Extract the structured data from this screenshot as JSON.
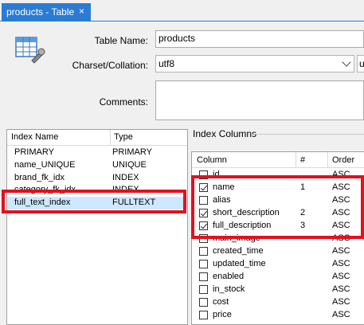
{
  "tab": {
    "title": "products - Table",
    "close_glyph": "×"
  },
  "form": {
    "table_name_label": "Table Name:",
    "table_name_value": "products",
    "charset_label": "Charset/Collation:",
    "charset_value": "utf8",
    "collation_value": "u",
    "comments_label": "Comments:",
    "comments_value": ""
  },
  "indexes": {
    "headers": [
      "Index Name",
      "Type"
    ],
    "rows": [
      {
        "name": "PRIMARY",
        "type": "PRIMARY"
      },
      {
        "name": "name_UNIQUE",
        "type": "UNIQUE"
      },
      {
        "name": "brand_fk_idx",
        "type": "INDEX"
      },
      {
        "name": "category_fk_idx",
        "type": "INDEX"
      },
      {
        "name": "full_text_index",
        "type": "FULLTEXT"
      }
    ],
    "selected_index": 4
  },
  "index_columns": {
    "title": "Index Columns",
    "headers": [
      "Column",
      "#",
      "Order"
    ],
    "rows": [
      {
        "name": "id",
        "checked": false,
        "num": "",
        "order": "ASC"
      },
      {
        "name": "name",
        "checked": true,
        "num": "1",
        "order": "ASC"
      },
      {
        "name": "alias",
        "checked": false,
        "num": "",
        "order": "ASC"
      },
      {
        "name": "short_description",
        "checked": true,
        "num": "2",
        "order": "ASC"
      },
      {
        "name": "full_description",
        "checked": true,
        "num": "3",
        "order": "ASC"
      },
      {
        "name": "main_image",
        "checked": false,
        "num": "",
        "order": "ASC"
      },
      {
        "name": "created_time",
        "checked": false,
        "num": "",
        "order": "ASC"
      },
      {
        "name": "updated_time",
        "checked": false,
        "num": "",
        "order": "ASC"
      },
      {
        "name": "enabled",
        "checked": false,
        "num": "",
        "order": "ASC"
      },
      {
        "name": "in_stock",
        "checked": false,
        "num": "",
        "order": "ASC"
      },
      {
        "name": "cost",
        "checked": false,
        "num": "",
        "order": "ASC"
      },
      {
        "name": "price",
        "checked": false,
        "num": "",
        "order": "ASC"
      }
    ]
  },
  "colors": {
    "tab_blue": "#2b7bd4",
    "highlight_red": "#e3101e",
    "selection": "#cde8ff"
  }
}
